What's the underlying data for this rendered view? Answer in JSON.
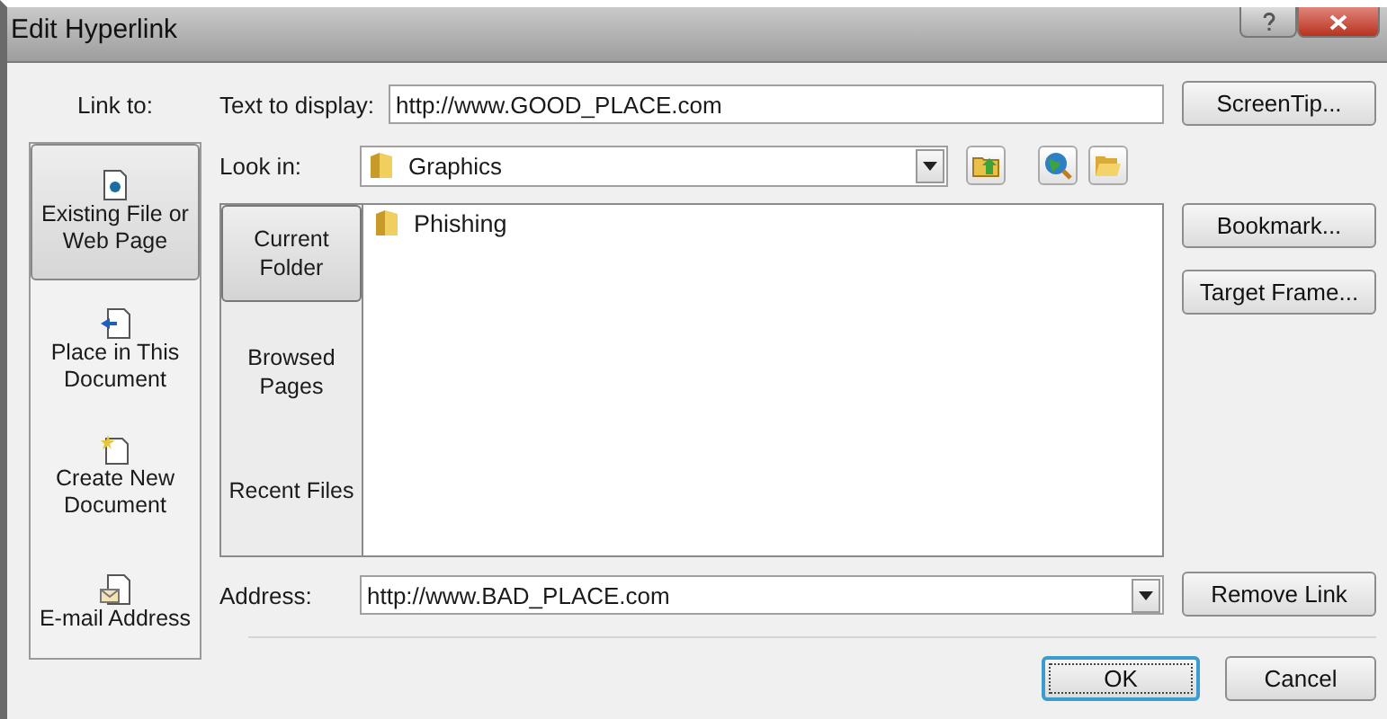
{
  "window": {
    "title": "Edit Hyperlink"
  },
  "link_to": {
    "label": "Link to:",
    "items": [
      {
        "label": "Existing File or Web Page",
        "kind": "file",
        "selected": true
      },
      {
        "label": "Place in This Document",
        "kind": "place",
        "selected": false
      },
      {
        "label": "Create New Document",
        "kind": "new",
        "selected": false
      },
      {
        "label": "E-mail Address",
        "kind": "email",
        "selected": false
      }
    ]
  },
  "text_to_display": {
    "label": "Text to display:",
    "value": "http://www.GOOD_PLACE.com"
  },
  "look_in": {
    "label": "Look in:",
    "value": "Graphics"
  },
  "browse_tabs": [
    {
      "label": "Current Folder",
      "selected": true
    },
    {
      "label": "Browsed Pages",
      "selected": false
    },
    {
      "label": "Recent Files",
      "selected": false
    }
  ],
  "files": [
    {
      "name": "Phishing"
    }
  ],
  "address": {
    "label": "Address:",
    "value": "http://www.BAD_PLACE.com"
  },
  "screentip_button": "ScreenTip...",
  "bookmark_button": "Bookmark...",
  "target_frame_button": "Target Frame...",
  "remove_link_button": "Remove Link",
  "dialog_buttons": [
    {
      "label": "OK",
      "default": true
    },
    {
      "label": "Cancel",
      "default": false
    }
  ]
}
